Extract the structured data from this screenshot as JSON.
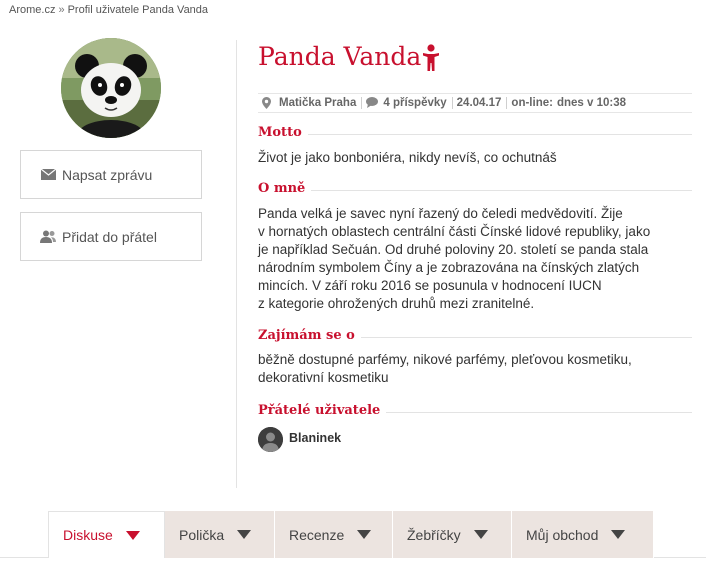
{
  "breadcrumb": {
    "home": "Arome.cz",
    "separator": "»",
    "current": "Profil uživatele Panda Vanda"
  },
  "profile": {
    "name": "Panda Vanda",
    "location": "Matička Praha",
    "posts": "4 příspěvky",
    "joined": "24.04.17",
    "online_label": "on-line:",
    "online_value": "dnes v 10:38"
  },
  "sidebar": {
    "message_label": "Napsat zprávu",
    "friend_label": "Přidat do přátel"
  },
  "sections": {
    "motto_title": "Motto",
    "motto_text": "Život je jako bonboniéra, nikdy nevíš, co ochutnáš",
    "about_title": "O mně",
    "about_lines": [
      "Panda velká je savec nyní řazený do čeledi medvědovití. Žije",
      "v hornatých oblastech centrální části Čínské lidové republiky, jako",
      "je například Sečuán. Od druhé poloviny 20. století se panda stala",
      "národním symbolem Číny a je zobrazována na čínských zlatých",
      "mincích. V září roku 2016 se posunula v hodnocení IUCN",
      "z kategorie ohrožených druhů mezi zranitelné."
    ],
    "interests_title": "Zajímám se o",
    "interests_lines": [
      "běžně dostupné parfémy, nikové parfémy, pleťovou kosmetiku,",
      "dekorativní kosmetiku"
    ],
    "friends_title": "Přátelé uživatele",
    "friends": [
      {
        "name": "Blaninek"
      }
    ]
  },
  "tabs": [
    {
      "label": "Diskuse",
      "active": true
    },
    {
      "label": "Polička"
    },
    {
      "label": "Recenze"
    },
    {
      "label": "Žebříčky"
    },
    {
      "label": "Můj obchod"
    }
  ],
  "colors": {
    "accent": "#c8102e",
    "tab_bg": "#ece4e0",
    "border": "#e3e3e3"
  },
  "icons": [
    "user-figure-icon",
    "location-pin-icon",
    "speech-bubble-icon",
    "envelope-icon",
    "users-icon",
    "dropdown-triangle-icon"
  ]
}
